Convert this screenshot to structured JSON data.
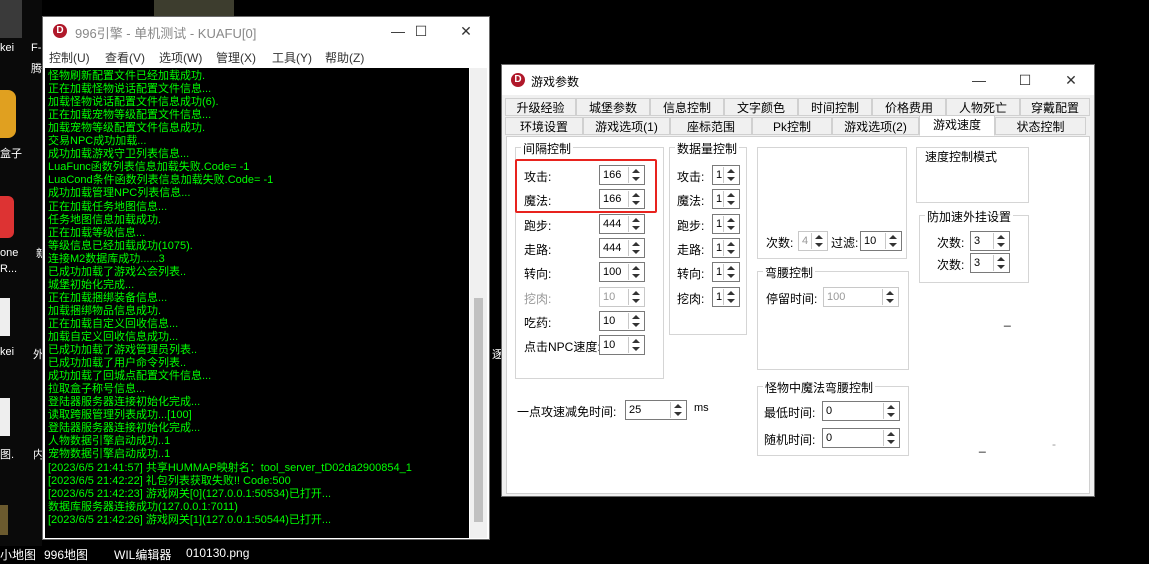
{
  "desktop": {
    "icons": [
      "kei",
      "F-",
      "腾",
      "盒子",
      "one",
      "R...",
      "新",
      "kei",
      "外",
      "图.",
      "内"
    ],
    "taskbar_labels": [
      "小地图",
      "996地图",
      "WIL编辑器",
      "010130.png"
    ],
    "stray_char": "逐"
  },
  "console": {
    "title": "996引擎 - 单机测试 - KUAFU[0]",
    "icon_letter": "D",
    "menu": [
      "控制(U)",
      "查看(V)",
      "选项(W)",
      "管理(X)",
      "工具(Y)",
      "帮助(Z)"
    ],
    "controls": {
      "minimize": "—",
      "maximize": "☐",
      "close": "✕"
    },
    "log_lines": [
      "怪物刷新配置文件已经加载成功.",
      "正在加载怪物说话配置文件信息...",
      "加载怪物说话配置文件信息成功(6).",
      "正在加载宠物等级配置文件信息...",
      "加载宠物等级配置文件信息成功.",
      "交易NPC成功加载...",
      "成功加载游戏守卫列表信息...",
      "LuaFunc函数列表信息加载失败.Code= -1",
      "LuaCond条件函数列表信息加载失败.Code= -1",
      "成功加载管理NPC列表信息...",
      "正在加载任务地图信息...",
      "任务地图信息加载成功.",
      "正在加载等级信息...",
      "等级信息已经加载成功(1075).",
      "连接M2数据库成功......3",
      "已成功加载了游戏公会列表..",
      "城堡初始化完成...",
      "正在加载捆绑装备信息...",
      "加载捆绑物品信息成功.",
      "正在加载自定义回收信息...",
      "加载自定义回收信息成功...",
      "已成功加载了游戏管理员列表..",
      "已成功加载了用户命令列表..",
      "成功加载了回城点配置文件信息...",
      "拉取盒子称号信息...",
      "登陆器服务器连接初始化完成...",
      "读取跨服管理列表成功...[100]",
      "登陆器服务器连接初始化完成...",
      "人物数据引擎启动成功..1",
      "宠物数据引擎启动成功..1",
      "[2023/6/5 21:41:57] 共享HUMMAP映射名：tool_server_tD02da2900854_1",
      "[2023/6/5 21:42:22] 礼包列表获取失败!! Code:500",
      "[2023/6/5 21:42:23] 游戏网关[0](127.0.0.1:50534)已打开...",
      "数据库服务器连接成功(127.0.0.1:7011)",
      "[2023/6/5 21:42:26] 游戏网关[1](127.0.0.1:50544)已打开..."
    ]
  },
  "dialog": {
    "title": "游戏参数",
    "icon_letter": "D",
    "controls": {
      "minimize": "—",
      "maximize": "☐",
      "close": "✕"
    },
    "tabs_row1": [
      "升级经验",
      "城堡参数",
      "信息控制",
      "文字颜色",
      "时间控制",
      "价格费用",
      "人物死亡",
      "穿戴配置"
    ],
    "tabs_row2": [
      "环境设置",
      "游戏选项(1)",
      "座标范围",
      "Pk控制",
      "游戏选项(2)",
      "游戏速度",
      "状态控制"
    ],
    "active_tab": "游戏速度",
    "interval": {
      "title": "间隔控制",
      "rows": [
        {
          "label": "攻击:",
          "value": "166"
        },
        {
          "label": "魔法:",
          "value": "166"
        },
        {
          "label": "跑步:",
          "value": "444"
        },
        {
          "label": "走路:",
          "value": "444"
        },
        {
          "label": "转向:",
          "value": "100"
        },
        {
          "label": "挖肉:",
          "value": "10"
        },
        {
          "label": "吃药:",
          "value": "10"
        },
        {
          "label": "点击NPC速度:",
          "value": "10"
        }
      ]
    },
    "count": {
      "title": "数据量控制",
      "rows": [
        {
          "label": "攻击:",
          "value": "1"
        },
        {
          "label": "魔法:",
          "value": "1"
        },
        {
          "label": "跑步:",
          "value": "1"
        },
        {
          "label": "走路:",
          "value": "1"
        },
        {
          "label": "转向:",
          "value": "1"
        },
        {
          "label": "挖肉:",
          "value": "1"
        }
      ]
    },
    "times": {
      "label": "次数:",
      "value": "4",
      "filter_label": "过滤:",
      "filter_value": "10"
    },
    "bow": {
      "title": "弯腰控制",
      "label": "停留时间:",
      "value": "100"
    },
    "speed_mode": {
      "title": "速度控制模式"
    },
    "anti_hack": {
      "title": "防加速外挂设置",
      "rows": [
        {
          "label": "次数:",
          "value": "3"
        },
        {
          "label": "次数:",
          "value": "3"
        }
      ]
    },
    "reduce": {
      "label": "一点攻速减免时间:",
      "value": "25",
      "unit": "ms"
    },
    "monster_bow": {
      "title": "怪物中魔法弯腰控制",
      "rows": [
        {
          "label": "最低时间:",
          "value": "0"
        },
        {
          "label": "随机时间:",
          "value": "0"
        }
      ]
    },
    "dash": "_",
    "dash_small": "-"
  }
}
